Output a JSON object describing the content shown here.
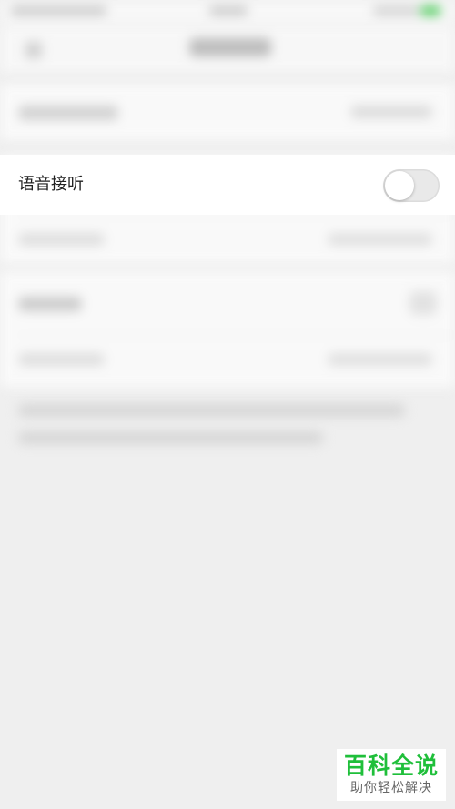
{
  "settings": {
    "voice_answer": {
      "label": "语音接听",
      "enabled": false
    }
  },
  "watermark": {
    "title": "百科全说",
    "subtitle": "助你轻松解决"
  },
  "colors": {
    "background": "#efefef",
    "toggle_off": "#e9e9e9",
    "watermark_green": "#1fbf3a"
  }
}
